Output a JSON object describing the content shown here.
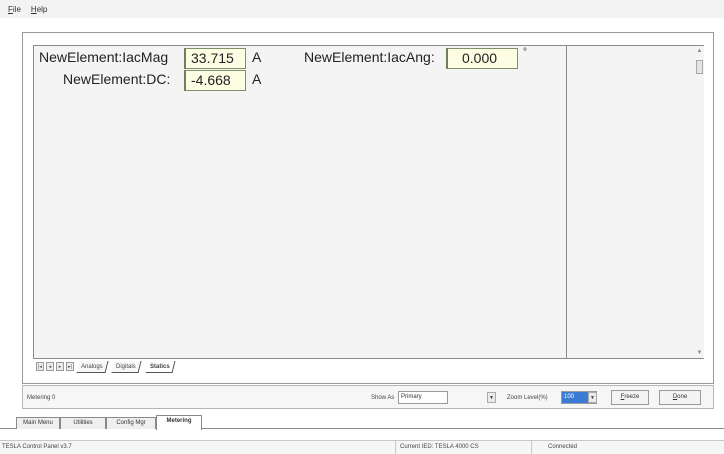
{
  "menu": [
    {
      "label": "File",
      "ul": "F",
      "rest": "ile"
    },
    {
      "label": "Help",
      "ul": "H",
      "rest": "elp"
    }
  ],
  "measurements": {
    "iac_mag": {
      "label": "NewElement:IacMag",
      "value": "33.715",
      "unit": "A"
    },
    "iac_ang": {
      "label": "NewElement:IacAng:",
      "value": "0.000",
      "unit": "°"
    },
    "dc": {
      "label": "NewElement:DC:",
      "value": "-4.668",
      "unit": "A"
    }
  },
  "page_nav": [
    "|◂",
    "◂",
    "▸",
    "▸|"
  ],
  "page_tabs": [
    {
      "label": "Analogs",
      "active": false
    },
    {
      "label": "Digitals",
      "active": false
    },
    {
      "label": "Statics",
      "active": true
    }
  ],
  "status": {
    "left_text": "Metering 0",
    "show_as_label": "Show As",
    "show_as_value": "Primary",
    "zoom_label": "Zoom Level(%)",
    "zoom_value": "100",
    "freeze_label": "Freeze",
    "freeze_ul": "F",
    "freeze_rest": "reeze",
    "done_label": "Done",
    "done_ul": "D",
    "done_rest": "one"
  },
  "main_tabs": [
    {
      "label": "Main Menu",
      "active": false
    },
    {
      "label": "Utilities",
      "active": false
    },
    {
      "label": "Config Mgr",
      "active": false
    },
    {
      "label": "Metering",
      "active": true
    }
  ],
  "footer": {
    "app_version": "TESLA Control Panel v3.7",
    "current_ied": "Current IED: TESLA 4000 CS",
    "connection": "Connected"
  },
  "colors": {
    "value_box_bg": "#fdfde4",
    "zoom_highlight": "#3a7bd5"
  }
}
